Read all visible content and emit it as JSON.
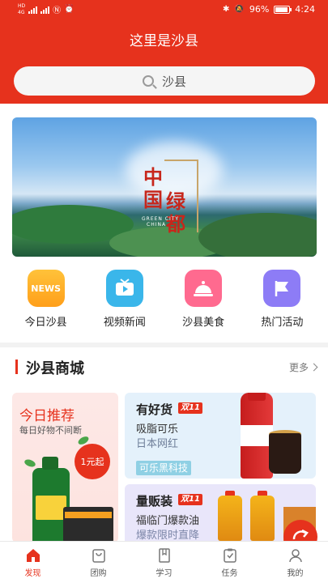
{
  "status_bar": {
    "sim1": "HD",
    "sim2": "4G",
    "battery_pct": "96%",
    "time": "4:24"
  },
  "header": {
    "title": "这里是沙县",
    "search_placeholder": "沙县"
  },
  "banner": {
    "chars": [
      "中",
      "国",
      "绿",
      "都"
    ],
    "sub_line1": "GREEN CITY",
    "sub_line2": "CHINA"
  },
  "categories": [
    {
      "label": "今日沙县",
      "icon": "news-icon",
      "icon_text": "NEWS",
      "color": "#ffae24"
    },
    {
      "label": "视频新闻",
      "icon": "tv-icon",
      "color": "#3ab6ea"
    },
    {
      "label": "沙县美食",
      "icon": "food-cloche-icon",
      "color": "#ff6a8f"
    },
    {
      "label": "热门活动",
      "icon": "flag-icon",
      "color": "#8d7cf6"
    }
  ],
  "shop": {
    "title": "沙县商城",
    "more": "更多",
    "recommend": {
      "title": "今日推荐",
      "subtitle": "每日好物不间断",
      "price": "1元起"
    },
    "good_goods": {
      "title": "有好货",
      "tag": "双11",
      "line1": "吸脂可乐",
      "line2": "日本网红",
      "badge": "可乐黑科技"
    },
    "bulk": {
      "title": "量贩装",
      "tag": "双11",
      "line1": "福临门爆款油",
      "line2": "爆款限时直降"
    }
  },
  "bottom_nav": [
    {
      "label": "发现",
      "icon": "home-icon",
      "active": true
    },
    {
      "label": "团购",
      "icon": "shopping-bag-icon",
      "active": false
    },
    {
      "label": "学习",
      "icon": "book-icon",
      "active": false
    },
    {
      "label": "任务",
      "icon": "clipboard-check-icon",
      "active": false
    },
    {
      "label": "我的",
      "icon": "user-icon",
      "active": false
    }
  ],
  "colors": {
    "brand_red": "#e6321d",
    "nav_active": "#e6321d"
  }
}
